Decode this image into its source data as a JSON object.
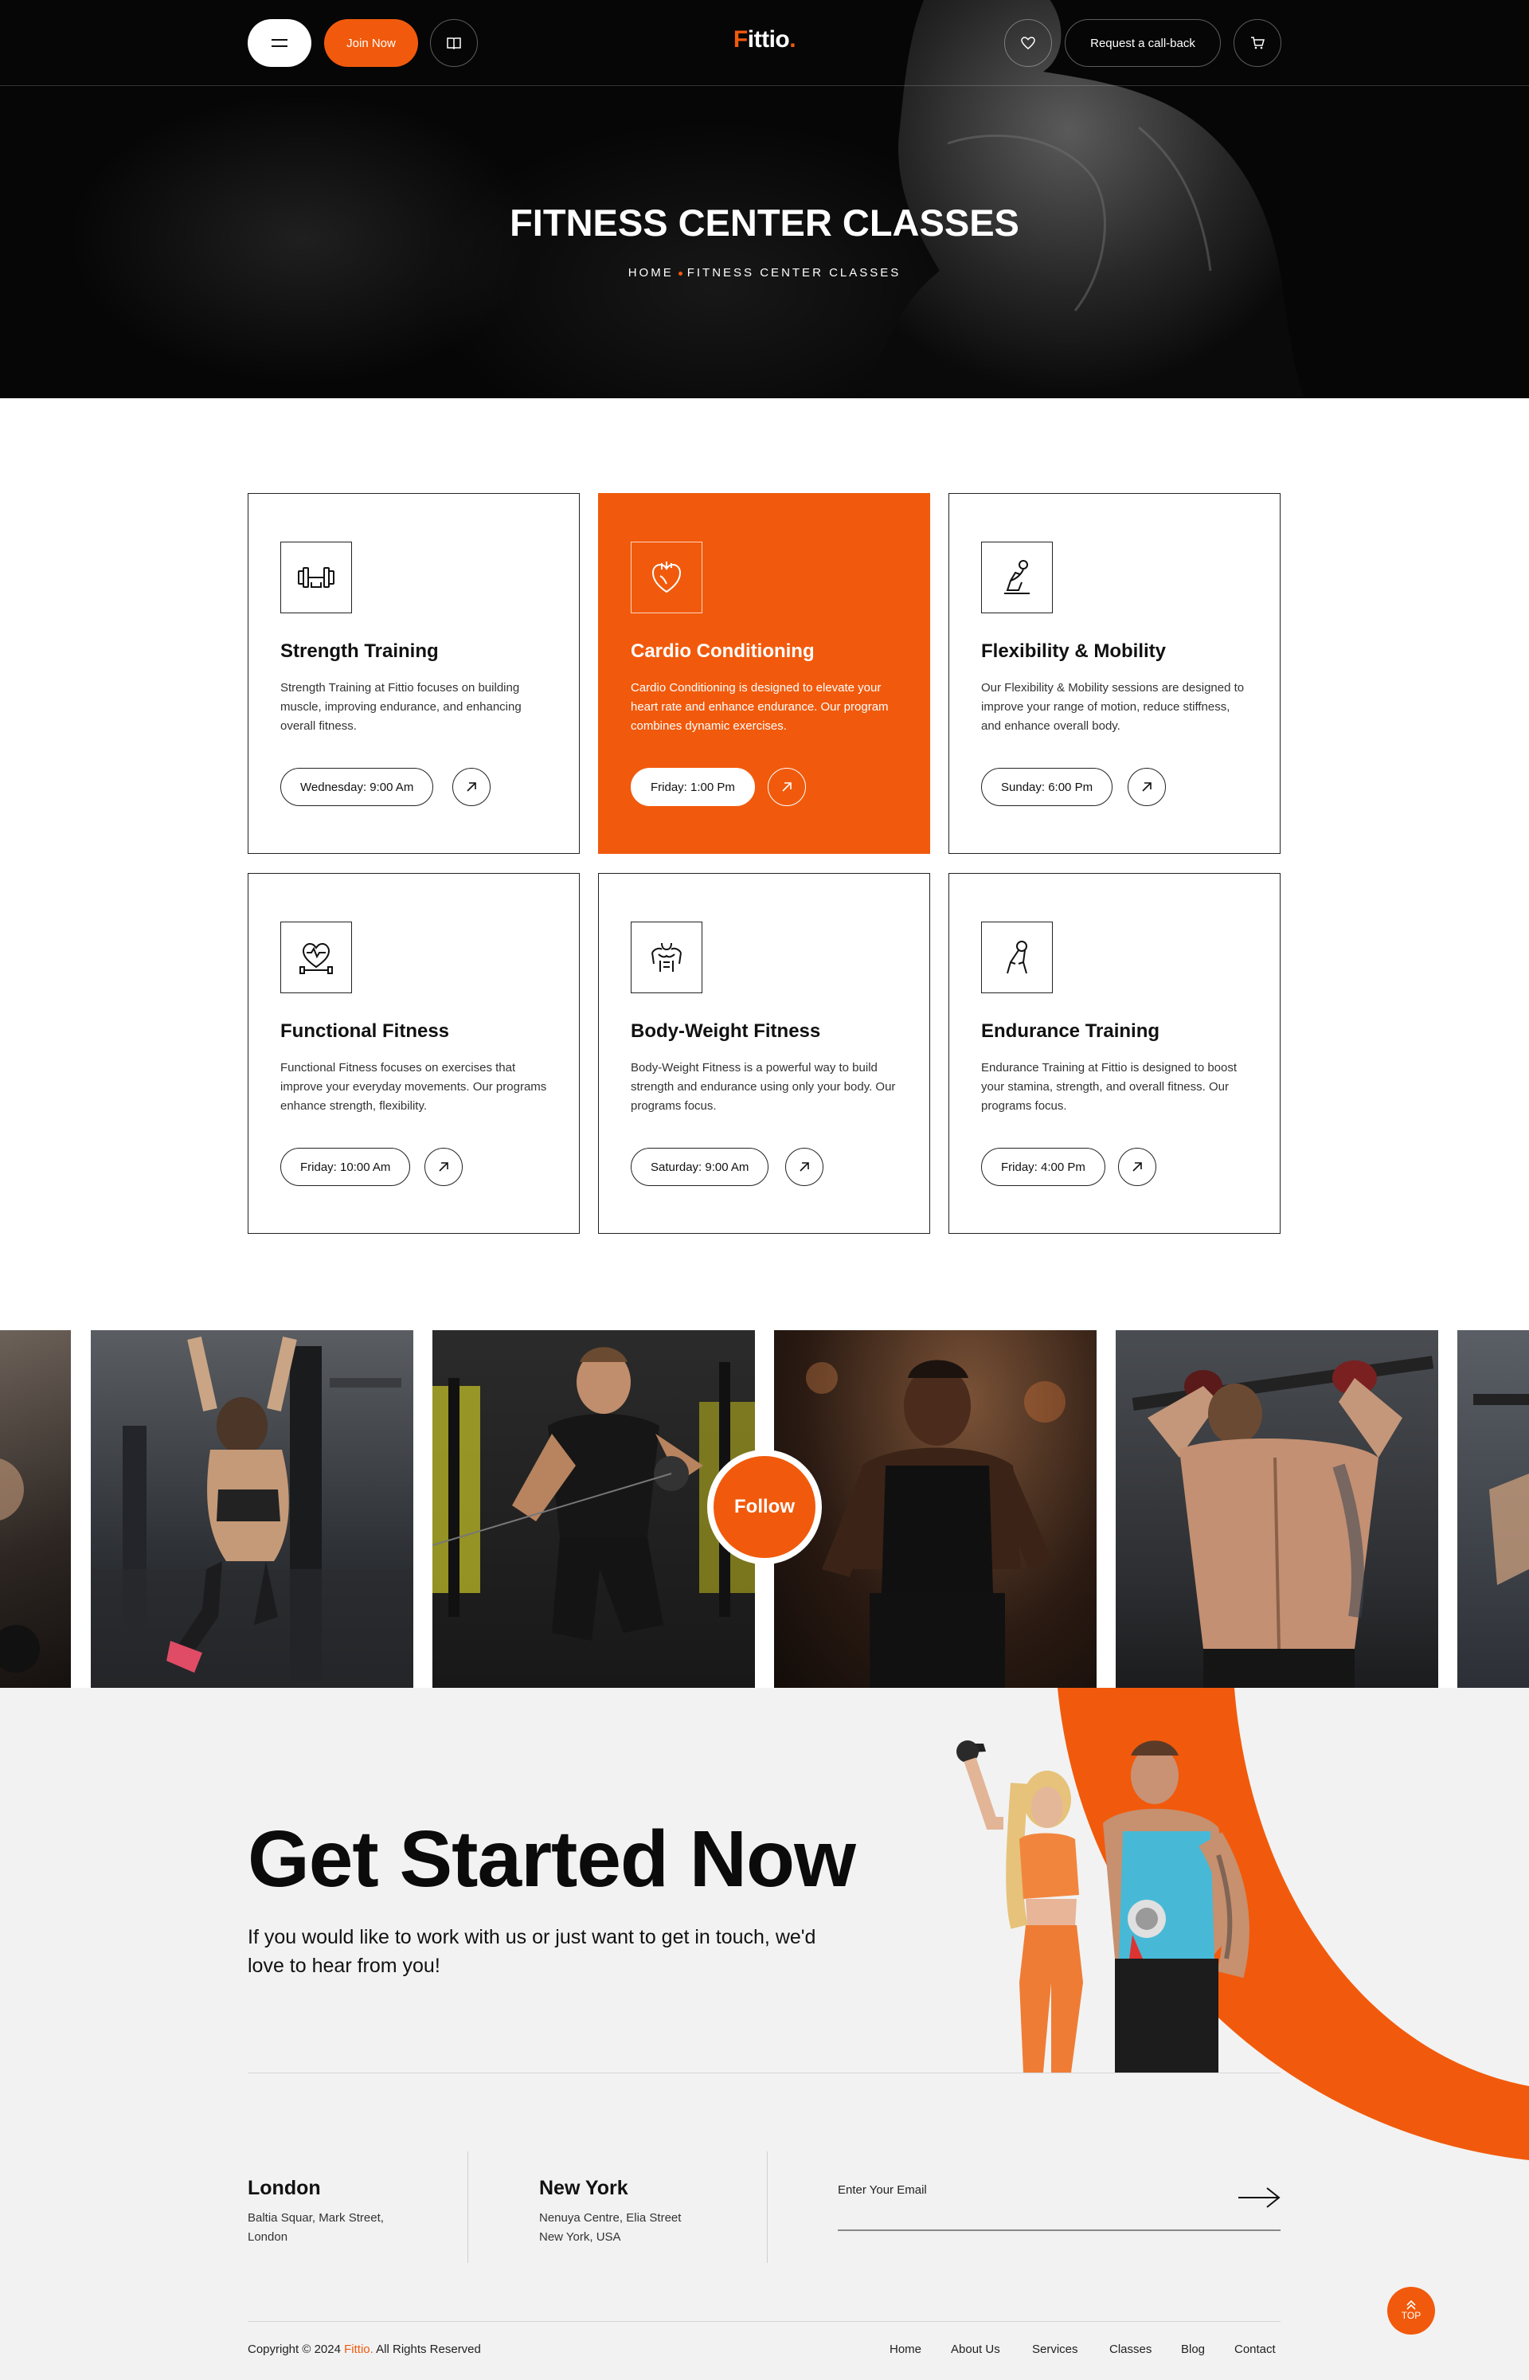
{
  "colors": {
    "accent": "#f15a0c",
    "hero_bg": "#060606",
    "footer_bg": "#f2f2f2"
  },
  "header": {
    "menu_icon": "menu-icon",
    "join_label": "Join Now",
    "book_icon": "book-icon",
    "logo_text": "Fittio",
    "logo_dot": ".",
    "wishlist_icon": "heart-icon",
    "callback_label": "Request a call-back",
    "cart_icon": "cart-icon"
  },
  "hero": {
    "title": "FITNESS CENTER CLASSES",
    "breadcrumb_home": "HOME",
    "breadcrumb_current": "FITNESS CENTER CLASSES"
  },
  "classes": [
    {
      "title": "Strength Training",
      "description": "Strength Training at Fittio focuses on building muscle, improving endurance, and enhancing overall fitness.",
      "schedule": "Wednesday: 9:00 Am",
      "icon": "dumbbell-icon"
    },
    {
      "title": "Cardio Conditioning",
      "description": "Cardio Conditioning is designed to elevate your heart rate and enhance endurance. Our program combines dynamic exercises.",
      "schedule": "Friday: 1:00 Pm",
      "icon": "heart-organ-icon"
    },
    {
      "title": "Flexibility & Mobility",
      "description": "Our Flexibility & Mobility sessions are designed to improve your range of motion, reduce stiffness, and enhance overall body.",
      "schedule": "Sunday: 6:00 Pm",
      "icon": "stretching-icon"
    },
    {
      "title": "Functional Fitness",
      "description": "Functional Fitness focuses on exercises that improve your everyday movements. Our programs enhance strength, flexibility.",
      "schedule": "Friday: 10:00 Am",
      "icon": "heart-dumbbell-icon"
    },
    {
      "title": "Body-Weight Fitness",
      "description": "Body-Weight Fitness is a powerful way to build strength and endurance using only your body. Our programs focus.",
      "schedule": "Saturday: 9:00 Am",
      "icon": "torso-icon"
    },
    {
      "title": "Endurance Training",
      "description": "Endurance Training at Fittio is designed to boost your stamina, strength, and overall fitness. Our programs focus.",
      "schedule": "Friday: 4:00 Pm",
      "icon": "hand-grip-icon"
    }
  ],
  "gallery": {
    "follow_label": "Follow"
  },
  "cta": {
    "title": "Get Started Now",
    "subtitle": "If you would like to work with us or just want to get in touch, we'd love to hear from you!"
  },
  "offices": [
    {
      "city": "London",
      "line1": "Baltia Squar, Mark Street,",
      "line2": "London"
    },
    {
      "city": "New York",
      "line1": "Nenuya Centre, Elia Street",
      "line2": "New York, USA"
    }
  ],
  "newsletter": {
    "placeholder": "Enter Your Email",
    "submit_icon": "arrow-right-icon"
  },
  "footer": {
    "copyright_prefix": "Copyright © 2024 ",
    "brand": "Fittio.",
    "copyright_suffix": " All Rights Reserved",
    "nav": [
      "Home",
      "About Us",
      "Services",
      "Classes",
      "Blog",
      "Contact"
    ],
    "top_label": "TOP"
  }
}
